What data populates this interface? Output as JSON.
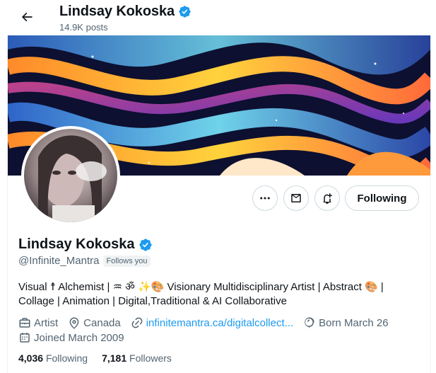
{
  "header": {
    "name": "Lindsay Kokoska",
    "posts": "14.9K posts"
  },
  "actions": {
    "more_icon": "more-icon",
    "message_icon": "message-icon",
    "notify_icon": "notification-bell-icon",
    "following_label": "Following"
  },
  "profile": {
    "name": "Lindsay Kokoska",
    "handle": "@Infinite_Mantra",
    "follows_you": "Follows you",
    "bio_line1": "Visual ☨ Alchemist | ♒ ॐ ✨🎨 Visionary Multidisciplinary Artist | Abstract 🎨 |",
    "bio_line2": "Collage | Animation | Digital,Traditional & AI Collaborative",
    "profession": "Artist",
    "location": "Canada",
    "website": "infinitemantra.ca/digitalcollect...",
    "birthday": "Born March 26",
    "joined": "Joined March 2009"
  },
  "stats": {
    "following_count": "4,036",
    "following_label": "Following",
    "followers_count": "7,181",
    "followers_label": "Followers"
  },
  "colors": {
    "accent": "#1d9bf0",
    "verified": "#1d9bf0",
    "text_secondary": "#536471"
  }
}
